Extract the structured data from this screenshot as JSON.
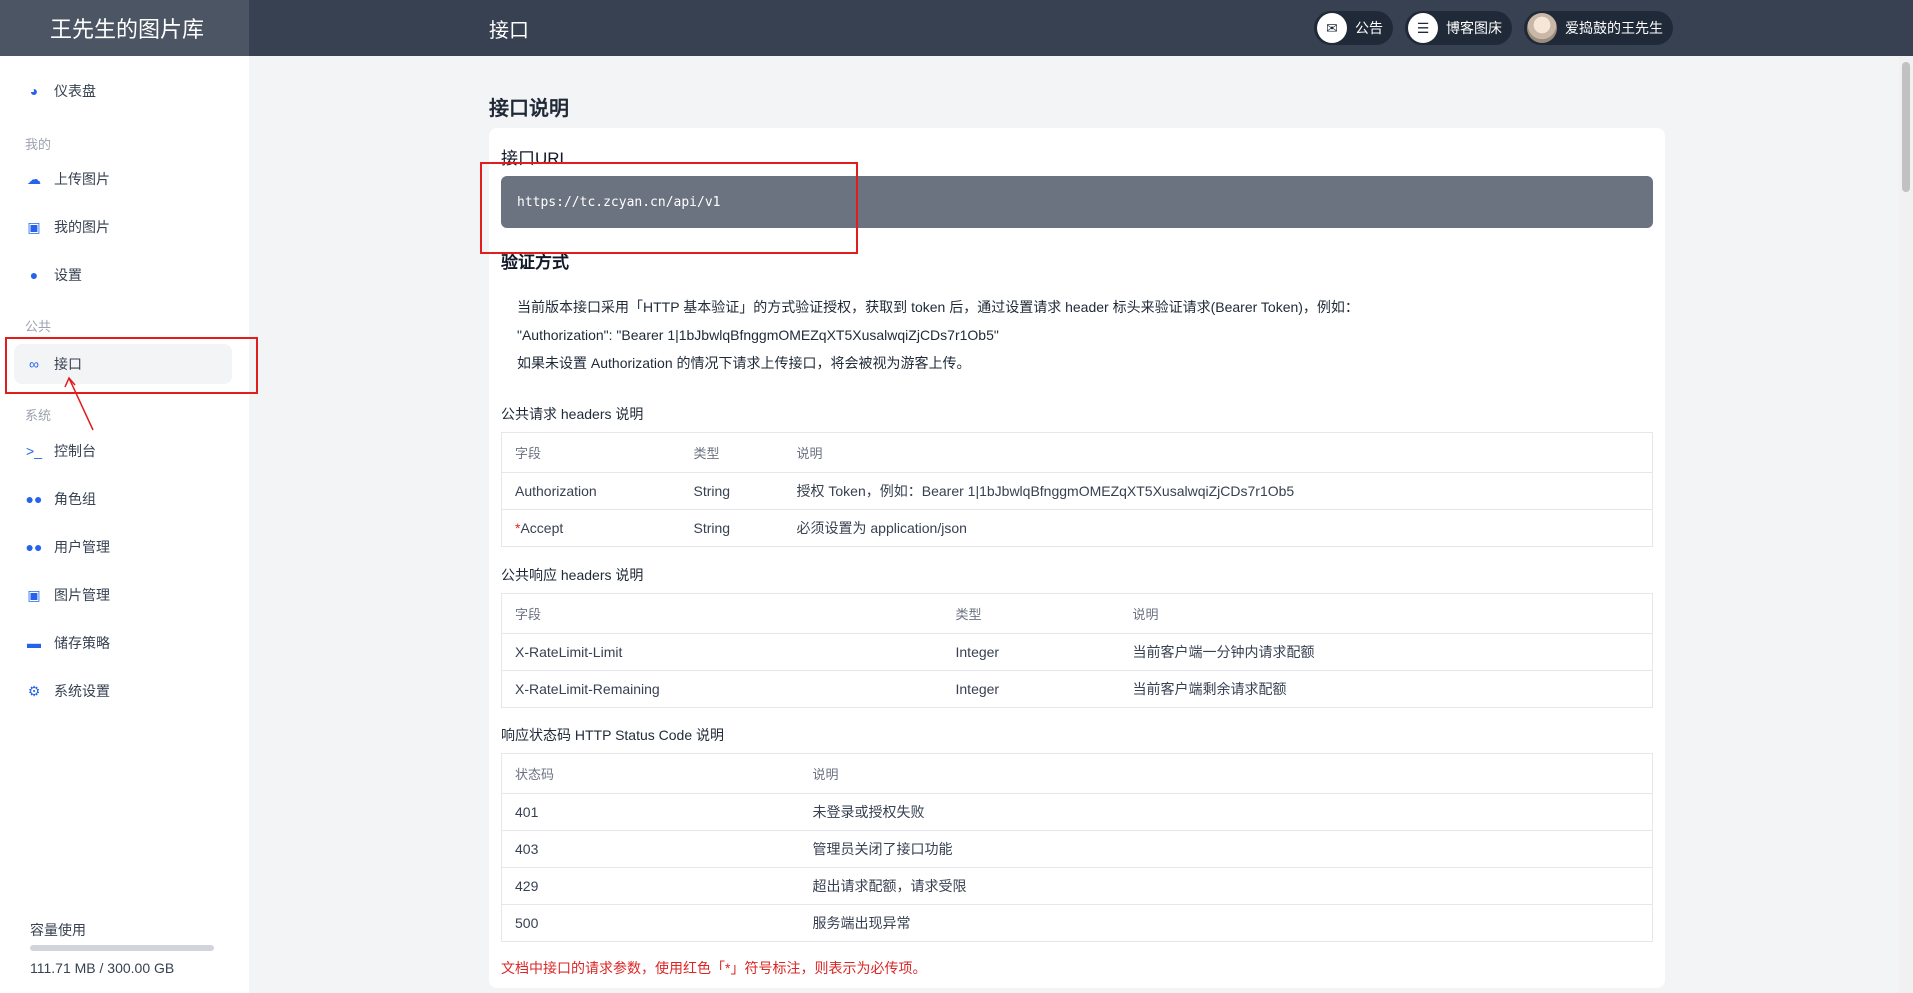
{
  "app": {
    "brand": "王先生的图片库",
    "page_title": "接口"
  },
  "top_actions": {
    "notice_label": "公告",
    "blog_label": "博客图床",
    "user_name": "爱捣鼓的王先生"
  },
  "sidebar": {
    "items": [
      {
        "label": "仪表盘"
      },
      {
        "label": "上传图片"
      },
      {
        "label": "我的图片"
      },
      {
        "label": "设置"
      },
      {
        "label": "接口"
      },
      {
        "label": "控制台"
      },
      {
        "label": "角色组"
      },
      {
        "label": "用户管理"
      },
      {
        "label": "图片管理"
      },
      {
        "label": "储存策略"
      },
      {
        "label": "系统设置"
      }
    ],
    "groups": {
      "mine": "我的",
      "public": "公共",
      "system": "系统"
    },
    "storage": {
      "label": "容量使用",
      "value": "111.71 MB / 300.00 GB",
      "used_fraction": 0.0004
    }
  },
  "main": {
    "heading": "接口说明",
    "url_title": "接口URL",
    "url": "https://tc.zcyan.cn/api/v1",
    "auth_title": "验证方式",
    "auth_lines": [
      "当前版本接口采用「HTTP 基本验证」的方式验证授权，获取到 token 后，通过设置请求 header 标头来验证请求(Bearer Token)，例如：",
      "\"Authorization\": \"Bearer 1|1bJbwlqBfnggmOMEZqXT5XusalwqiZjCDs7r1Ob5\"",
      "如果未设置 Authorization 的情况下请求上传接口，将会被视为游客上传。"
    ],
    "req_headers": {
      "title": "公共请求 headers 说明",
      "columns": [
        "字段",
        "类型",
        "说明"
      ],
      "rows": [
        {
          "field": "Authorization",
          "type": "String",
          "desc": "授权 Token，例如：Bearer 1|1bJbwlqBfnggmOMEZqXT5XusalwqiZjCDs7r1Ob5"
        },
        {
          "required_mark": "*",
          "field": "Accept",
          "type": "String",
          "desc": "必须设置为 application/json"
        }
      ]
    },
    "resp_headers": {
      "title": "公共响应 headers 说明",
      "columns": [
        "字段",
        "类型",
        "说明"
      ],
      "rows": [
        {
          "field": "X-RateLimit-Limit",
          "type": "Integer",
          "desc": "当前客户端一分钟内请求配额"
        },
        {
          "field": "X-RateLimit-Remaining",
          "type": "Integer",
          "desc": "当前客户端剩余请求配额"
        }
      ]
    },
    "status_codes": {
      "title": "响应状态码 HTTP Status Code 说明",
      "columns": [
        "状态码",
        "说明"
      ],
      "rows": [
        {
          "code": "401",
          "desc": "未登录或授权失败"
        },
        {
          "code": "403",
          "desc": "管理员关闭了接口功能"
        },
        {
          "code": "429",
          "desc": "超出请求配额，请求受限"
        },
        {
          "code": "500",
          "desc": "服务端出现异常"
        }
      ]
    },
    "note": "文档中接口的请求参数，使用红色「*」符号标注，则表示为必传项。"
  }
}
